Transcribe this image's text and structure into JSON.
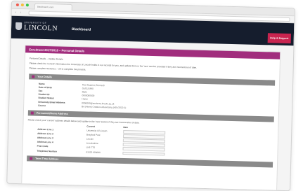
{
  "browser": {
    "tab_title": "Blackboard Learn",
    "nav_arrows": "‹ ›",
    "colors": {
      "close": "#ef5b4f",
      "minimize": "#f6be3b",
      "maximize": "#38c84a"
    }
  },
  "header": {
    "university_small": "UNIVERSITY OF",
    "university_big": "LINCOLN",
    "product": "Blackboard",
    "user_strip": "",
    "help_button": "Help & Support",
    "brand_color": "#151d2d",
    "accent": "#c8244f"
  },
  "page": {
    "title": "Enrolment 2017/2018 – Personal Details",
    "breadcrumb": "Personal Details – Update Details",
    "para1": "Please check the 'current' information the University of Lincoln holds in our records for you, and update them in the 'new' section provided if they are incorrect/out of date.",
    "para2": "Please complete sections 1 - 20 to complete the process."
  },
  "sections": {
    "your_details": "Your Details",
    "home_address": "Permanent/Home Address",
    "term_address": "Term Time Address"
  },
  "details": [
    {
      "label": "Name",
      "value": "Test Student, Emma B"
    },
    {
      "label": "Date of Birth",
      "value": "01/01/1990"
    },
    {
      "label": "Sex",
      "value": "Male"
    },
    {
      "label": "Student ID",
      "value": "0000000000"
    },
    {
      "label": "Student Status",
      "value": "Home"
    },
    {
      "label": "University Email Address",
      "value": "0000000@students.lincoln.ac.uk"
    },
    {
      "label": "Course",
      "value": "BA (Hons) Creative Advertising (ADV2022-2)"
    }
  ],
  "address_intro": "Please check your 'current' address details below and update in the 'new' section if they are incorrect/out of date.",
  "address_columns": {
    "current": "Current",
    "new": "New"
  },
  "address": [
    {
      "label": "Address Line 1",
      "current": "University Of Lincoln"
    },
    {
      "label": "Address Line 2",
      "current": "Brayford Pool"
    },
    {
      "label": "Address Line 3",
      "current": "Lincoln"
    },
    {
      "label": "Address Line 4",
      "current": "Lincolnshire"
    },
    {
      "label": "Post Code",
      "current": "LN6 7TS"
    },
    {
      "label": "Telephone Number",
      "current": "01522 000000"
    }
  ]
}
